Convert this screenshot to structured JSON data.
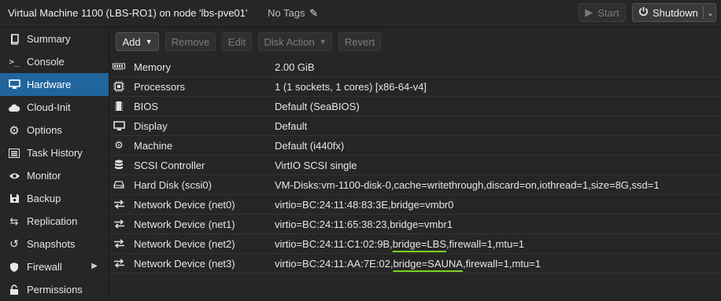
{
  "header": {
    "title": "Virtual Machine 1100 (LBS-RO1) on node 'lbs-pve01'",
    "tags_label": "No Tags",
    "start_label": "Start",
    "shutdown_label": "Shutdown"
  },
  "sidebar": {
    "items": [
      {
        "label": "Summary",
        "icon": "book-icon"
      },
      {
        "label": "Console",
        "icon": "terminal-icon"
      },
      {
        "label": "Hardware",
        "icon": "desktop-icon",
        "active": true
      },
      {
        "label": "Cloud-Init",
        "icon": "cloud-icon"
      },
      {
        "label": "Options",
        "icon": "gear-icon"
      },
      {
        "label": "Task History",
        "icon": "list-icon"
      },
      {
        "label": "Monitor",
        "icon": "eye-icon"
      },
      {
        "label": "Backup",
        "icon": "floppy-icon"
      },
      {
        "label": "Replication",
        "icon": "retweet-icon"
      },
      {
        "label": "Snapshots",
        "icon": "history-icon"
      },
      {
        "label": "Firewall",
        "icon": "shield-icon"
      },
      {
        "label": "Permissions",
        "icon": "unlock-icon"
      }
    ]
  },
  "toolbar": {
    "add_label": "Add",
    "remove_label": "Remove",
    "edit_label": "Edit",
    "disk_action_label": "Disk Action",
    "revert_label": "Revert"
  },
  "hardware": {
    "rows": [
      {
        "name": "Memory",
        "value": "2.00 GiB",
        "icon": "memory-icon"
      },
      {
        "name": "Processors",
        "value": "1 (1 sockets, 1 cores) [x86-64-v4]",
        "icon": "cpu-icon"
      },
      {
        "name": "BIOS",
        "value": "Default (SeaBIOS)",
        "icon": "microchip-icon"
      },
      {
        "name": "Display",
        "value": "Default",
        "icon": "display-icon"
      },
      {
        "name": "Machine",
        "value": "Default (i440fx)",
        "icon": "cogs-icon"
      },
      {
        "name": "SCSI Controller",
        "value": "VirtIO SCSI single",
        "icon": "database-icon"
      },
      {
        "name": "Hard Disk (scsi0)",
        "value": "VM-Disks:vm-1100-disk-0,cache=writethrough,discard=on,iothread=1,size=8G,ssd=1",
        "icon": "hdd-icon"
      },
      {
        "name": "Network Device (net0)",
        "value": "virtio=BC:24:11:48:83:3E,bridge=vmbr0",
        "icon": "exchange-icon"
      },
      {
        "name": "Network Device (net1)",
        "value": "virtio=BC:24:11:65:38:23,bridge=vmbr1",
        "icon": "exchange-icon"
      },
      {
        "name": "Network Device (net2)",
        "value_pre": "virtio=BC:24:11:C1:02:9B,",
        "value_hl": "bridge=LBS",
        "value_post": ",firewall=1,mtu=1",
        "icon": "exchange-icon"
      },
      {
        "name": "Network Device (net3)",
        "value_pre": "virtio=BC:24:11:AA:7E:02,",
        "value_hl": "bridge=SAUNA",
        "value_post": ",firewall=1,mtu=1",
        "icon": "exchange-icon"
      }
    ]
  },
  "colors": {
    "accent": "#21659e",
    "annotation": "#7ed321"
  }
}
